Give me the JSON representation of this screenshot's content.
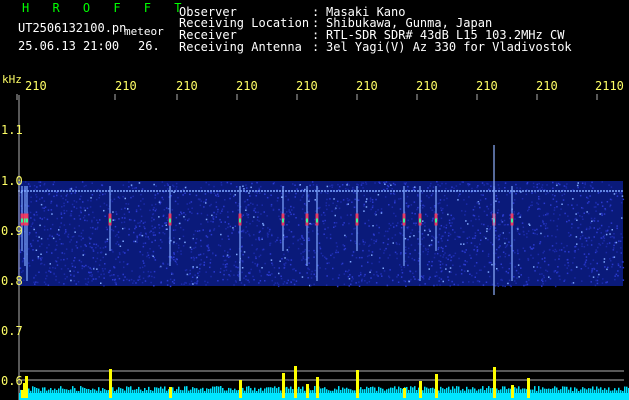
{
  "header": {
    "title": "H R O F F T",
    "filename": "UT2506132100.pn",
    "mode": "meteor",
    "datetime": "25.06.13 21:00",
    "count": "26.",
    "unit": "kHz"
  },
  "metadata": [
    {
      "label": "Observer",
      "value": "Masaki Kano"
    },
    {
      "label": "Receiving Location",
      "value": "Shibukawa, Gunma, Japan"
    },
    {
      "label": "Receiver",
      "value": "RTL-SDR SDR# 43dB L15 103.2MHz CW"
    },
    {
      "label": "Receiving Antenna",
      "value": "3el Yagi(V) Az 330 for Vladivostok"
    }
  ],
  "time_ticks": [
    "210",
    "210",
    "210",
    "210",
    "210",
    "210",
    "210",
    "210",
    "210",
    "2110"
  ],
  "freq_ticks": [
    "1.1",
    "1.0",
    "0.9",
    "0.8",
    "0.7",
    "0.6"
  ],
  "colors": {
    "background": "#000000",
    "grid": "#b0b0b0",
    "noise_dark": "#0a1a7a",
    "noise_mid": "#2a3acf",
    "noise_bright": "#7fa8ff",
    "echo": "#ff3355",
    "echo_mid": "#33ff99",
    "count_bars": "#ffff00",
    "base_line": "#00e5ff",
    "text": "#ffffff",
    "title": "#00ff00"
  },
  "spectrogram": {
    "freq_range_khz": [
      0.55,
      1.15
    ],
    "band_khz": [
      0.79,
      1.0
    ],
    "carrier_khz": 0.98,
    "echo_count": 26
  }
}
